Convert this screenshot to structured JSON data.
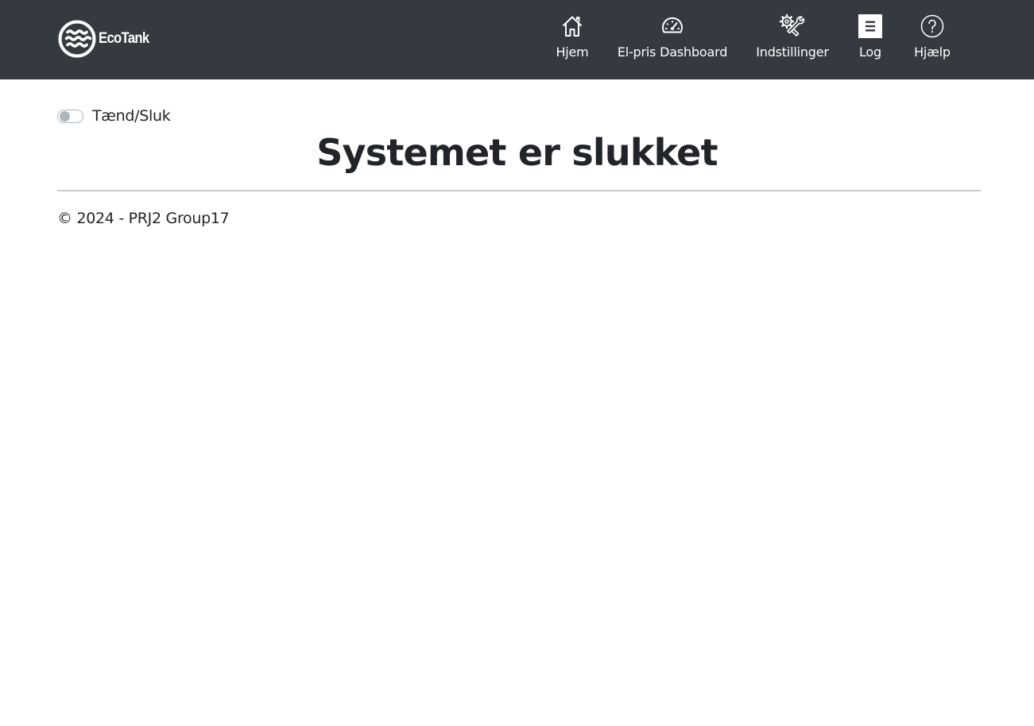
{
  "header": {
    "brand": {
      "name": "EcoTank",
      "logo_icon": "waves-circle-logo"
    },
    "nav": [
      {
        "label": "Hjem",
        "icon": "home-icon"
      },
      {
        "label": "El-pris Dashboard",
        "icon": "speedometer-icon"
      },
      {
        "label": "Indstillinger",
        "icon": "tools-icon"
      },
      {
        "label": "Log",
        "icon": "list-box-icon"
      },
      {
        "label": "Hjælp",
        "icon": "question-circle-icon"
      }
    ]
  },
  "main": {
    "power_toggle": {
      "label": "Tænd/Sluk",
      "checked": false
    },
    "status_title": "Systemet er slukket"
  },
  "footer": {
    "text": "© 2024 - PRJ2 Group17"
  },
  "colors": {
    "navbar_bg": "#343a40",
    "text": "#212529",
    "white": "#ffffff",
    "toggle_off": "#adb5bd",
    "divider": "#c7c9cb"
  }
}
